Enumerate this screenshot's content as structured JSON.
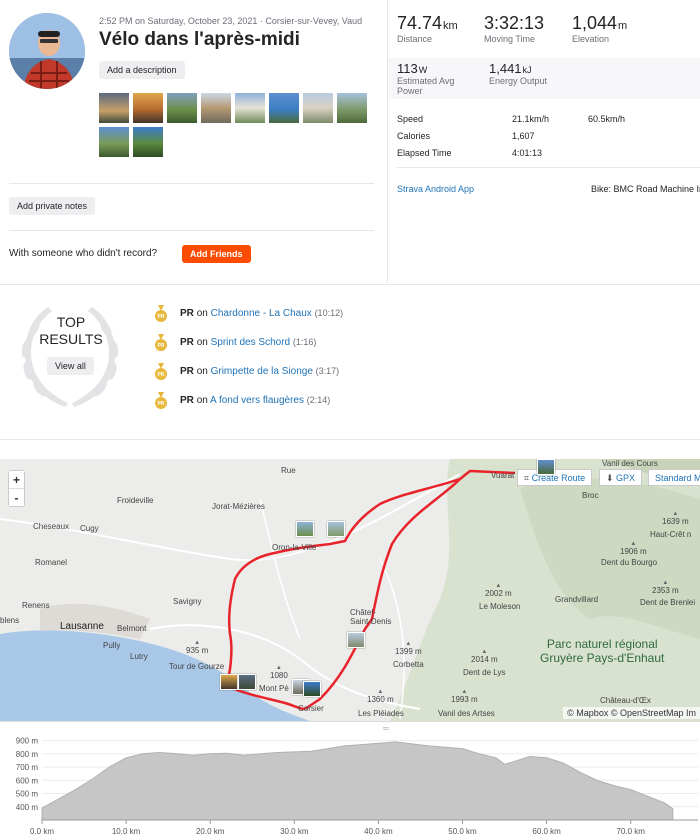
{
  "activity": {
    "meta": "2:52 PM on Saturday, October 23, 2021 · Corsier-sur-Vevey, Vaud",
    "title": "Vélo dans l'après-midi",
    "add_description": "Add a description",
    "add_private_notes": "Add private notes",
    "with_someone": "With someone who didn't record?",
    "add_friends": "Add Friends"
  },
  "stats": {
    "distance": {
      "value": "74.74",
      "unit": "km",
      "label": "Distance"
    },
    "moving_time": {
      "value": "3:32:13",
      "label": "Moving Time"
    },
    "elevation": {
      "value": "1,044",
      "unit": "m",
      "label": "Elevation"
    },
    "power": {
      "value": "113",
      "unit": "W",
      "label": "Estimated Avg Power"
    },
    "energy": {
      "value": "1,441",
      "unit": "kJ",
      "label": "Energy Output"
    }
  },
  "secondary": [
    {
      "label": "Speed",
      "value": "21.1km/h",
      "max": "60.5km/h"
    },
    {
      "label": "Calories",
      "value": "1,607",
      "max": ""
    },
    {
      "label": "Elapsed Time",
      "value": "4:01:13",
      "max": ""
    }
  ],
  "device": "Strava Android App",
  "bike": "Bike: BMC Road Machine Ir",
  "top_results": {
    "title": "Top Results",
    "view_all": "View all",
    "prs": [
      {
        "pr": "PR",
        "on": "on",
        "segment": "Chardonne - La Chaux",
        "time": "(10:12)"
      },
      {
        "pr": "PR",
        "on": "on",
        "segment": "Sprint des Schord",
        "time": "(1:16)"
      },
      {
        "pr": "PR",
        "on": "on",
        "segment": "Grimpette de la Sionge",
        "time": "(3:17)"
      },
      {
        "pr": "PR",
        "on": "on",
        "segment": "A fond vers flaugères",
        "time": "(2:14)"
      }
    ]
  },
  "map": {
    "zoom_in": "+",
    "zoom_out": "-",
    "create_route": "Create Route",
    "gpx": "GPX",
    "standard": "Standard M",
    "attribution": "© Mapbox © OpenStreetMap Im",
    "labels": {
      "rue": "Rue",
      "vanil_des_cours": "Vanil des Cours",
      "vuarat": "Vuarat",
      "froideville": "Froideville",
      "jorat_mezieres": "Jorat-Mézières",
      "broc": "Broc",
      "cheseaux": "Cheseaux",
      "cugy": "Cugy",
      "oron": "Oron-la-Ville",
      "peak_1639": "1639 m",
      "haut_cret": "Haut-Crêt n",
      "romanel": "Romanel",
      "peak_1906": "1906 m",
      "dent_bourgo": "Dent du Bourgo",
      "peak_2002": "2002 m",
      "le_moleson": "Le Moleson",
      "grandvillard": "Grandvillard",
      "peak_2353": "2353 m",
      "dent_brenleire": "Dent de Brenlei",
      "renens": "Renens",
      "savigny": "Savigny",
      "chatel": "Châtel-\nSaint-Denis",
      "blens": "blens",
      "lausanne": "Lausanne",
      "belmont": "Belmont",
      "pully": "Pully",
      "lutry": "Lutry",
      "peak_935": "935 m",
      "tour_gourze": "Tour de Gourze",
      "peak_1399": "1399 m",
      "corbetta": "Corbetta",
      "park": "Parc naturel régional\nGruyère Pays-d'Enhaut",
      "peak_2014": "2014 m",
      "dent_lys": "Dent de Lys",
      "peak_1080": "1080",
      "mont_pe": "Mont Pè",
      "corsier": "Corsier",
      "peak_1360": "1360 m",
      "les_pleiades": "Les Pléiades",
      "peak_1993": "1993 m",
      "vanil_artses": "Vanil des Artses",
      "chateau_oex": "Château-d'Œx"
    }
  },
  "elevation": {
    "y_ticks": [
      "900 m",
      "800 m",
      "700 m",
      "600 m",
      "500 m",
      "400 m"
    ],
    "x_ticks": [
      "0.0 km",
      "10.0 km",
      "20.0 km",
      "30.0 km",
      "40.0 km",
      "50.0 km",
      "60.0 km",
      "70.0 km"
    ],
    "chart_data": {
      "type": "area",
      "xlabel": "",
      "ylabel": "",
      "ylim": [
        300,
        950
      ],
      "xlim": [
        0,
        78
      ],
      "x": [
        0,
        2,
        4,
        6,
        8,
        10,
        12,
        14,
        16,
        18,
        20,
        22,
        24,
        26,
        28,
        30,
        32,
        34,
        36,
        38,
        40,
        42,
        44,
        46,
        48,
        50,
        52,
        54,
        55,
        56,
        58,
        60,
        62,
        64,
        66,
        68,
        70,
        72,
        74,
        75
      ],
      "y": [
        390,
        460,
        530,
        610,
        700,
        770,
        800,
        810,
        800,
        790,
        800,
        805,
        790,
        800,
        810,
        815,
        820,
        840,
        860,
        870,
        880,
        890,
        875,
        860,
        850,
        840,
        800,
        770,
        720,
        740,
        780,
        770,
        730,
        660,
        600,
        560,
        530,
        480,
        430,
        385
      ]
    }
  }
}
